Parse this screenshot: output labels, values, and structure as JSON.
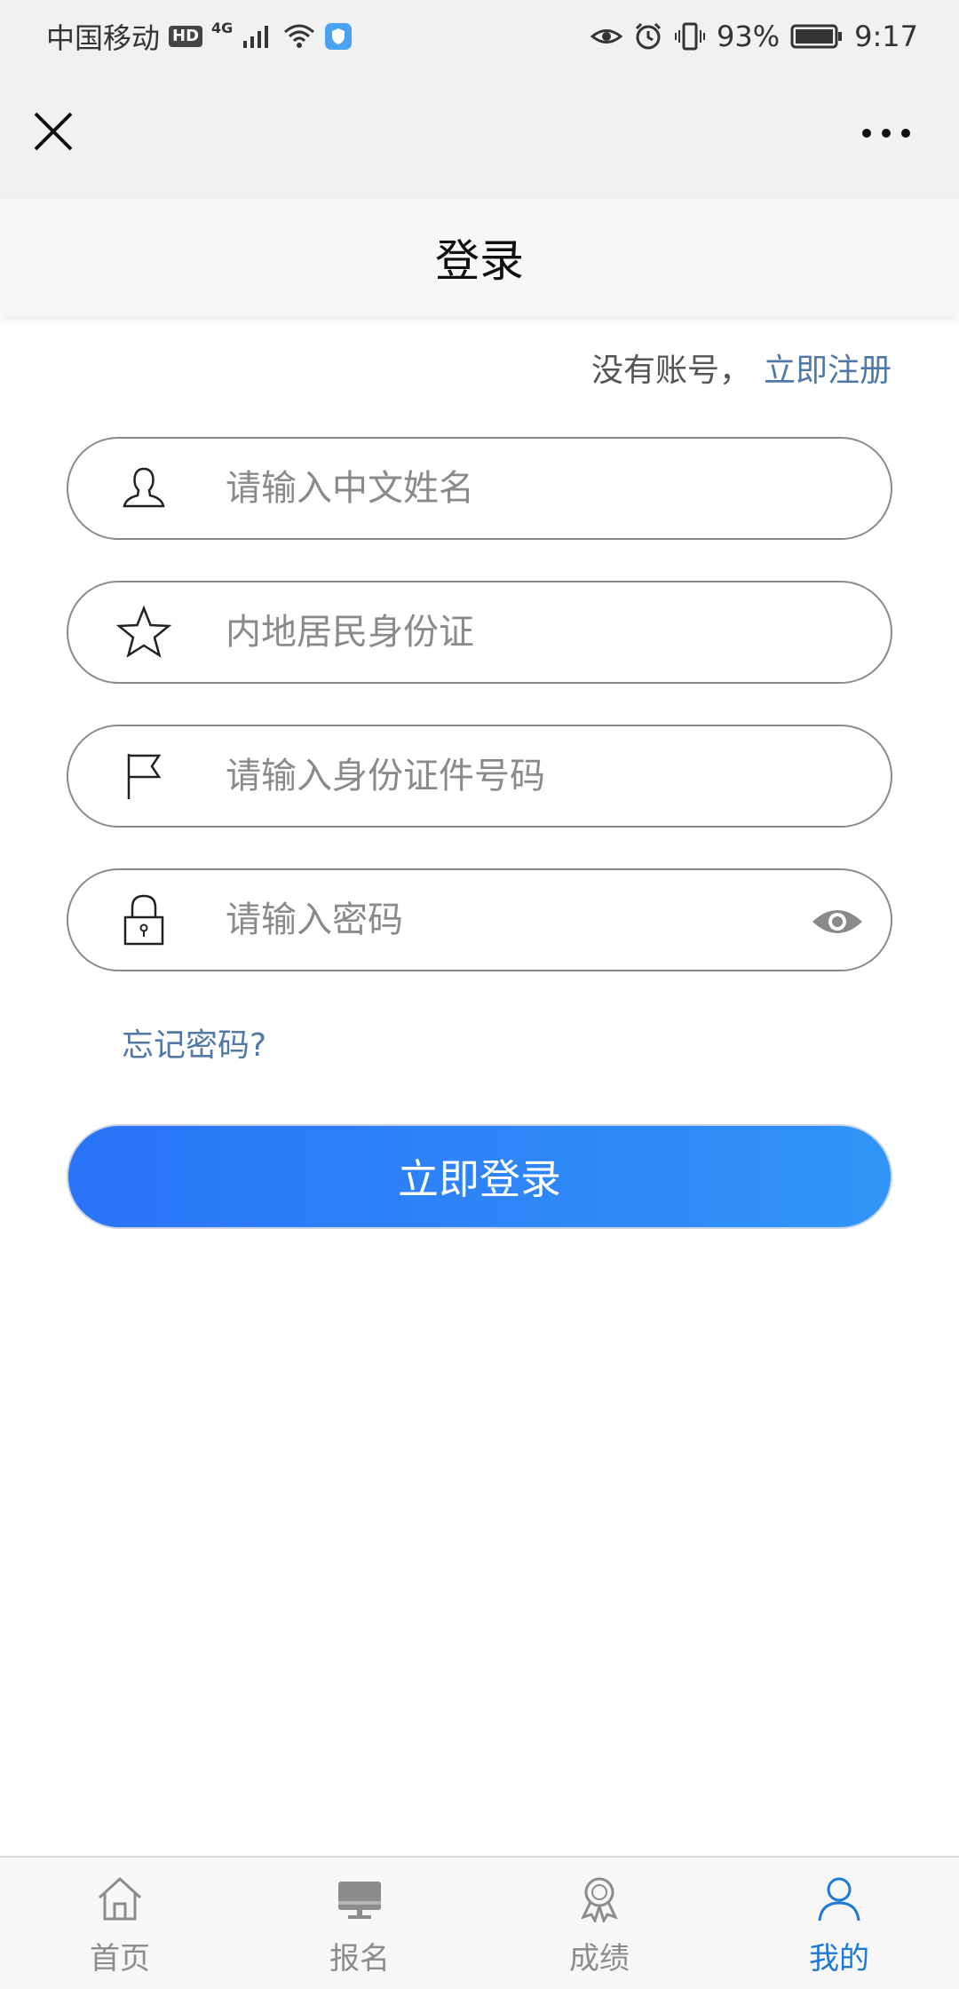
{
  "status_bar": {
    "carrier": "中国移动",
    "hd": "HD",
    "network": "4G",
    "battery": "93%",
    "time": "9:17"
  },
  "header": {
    "title": "登录"
  },
  "register": {
    "prompt": "没有账号，",
    "link": "立即注册"
  },
  "form": {
    "name_placeholder": "请输入中文姓名",
    "id_type_value": "内地居民身份证",
    "id_number_placeholder": "请输入身份证件号码",
    "password_placeholder": "请输入密码",
    "forgot_label": "忘记密码?",
    "submit_label": "立即登录"
  },
  "tabs": [
    {
      "label": "首页",
      "icon": "home-icon"
    },
    {
      "label": "报名",
      "icon": "monitor-icon"
    },
    {
      "label": "成绩",
      "icon": "award-icon"
    },
    {
      "label": "我的",
      "icon": "user-icon",
      "active": true
    }
  ],
  "colors": {
    "accent": "#1d78d6",
    "link": "#5078a8",
    "button_start": "#2a73f7",
    "button_end": "#3195f7"
  }
}
